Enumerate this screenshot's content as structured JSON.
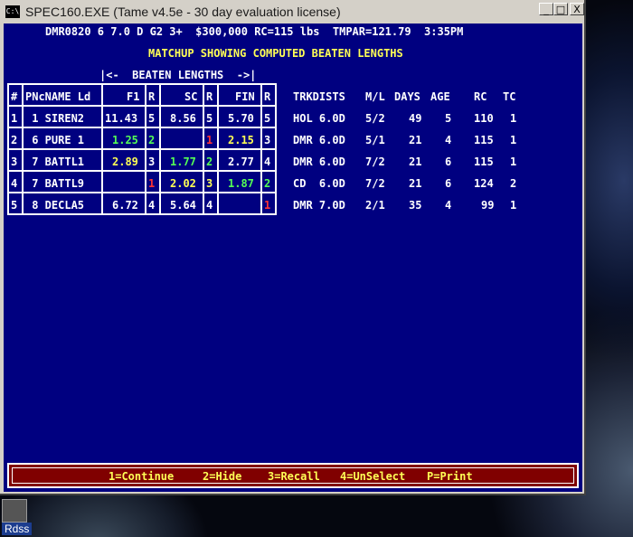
{
  "window": {
    "title": "SPEC160.EXE (Tame v4.5e - 30 day evaluation license)",
    "min_glyph": "_",
    "max_glyph": "□",
    "close_glyph": "X",
    "icon_text": "C:\\"
  },
  "header": {
    "race_info": "DMR0820 6 7.0 D G2 3+  $300,000 RC=115 lbs  TMPAR=121.79  3:35PM",
    "subtitle": "MATCHUP SHOWING COMPUTED BEATEN LENGTHS",
    "beaten_label": "|<-  BEATEN LENGTHS  ->|"
  },
  "table": {
    "headers": {
      "num": "#",
      "pn_name": "PNcNAME Ld",
      "f1": "F1",
      "r1": "R",
      "sc": "SC",
      "r2": "R",
      "fin": "FIN",
      "r3": "R",
      "trkdists": "TRKDISTS",
      "ml": "M/L",
      "days": "DAYS",
      "age": "AGE",
      "rc": "RC",
      "tc": "TC"
    },
    "rows": [
      {
        "num": "1",
        "pn_name": " 1 SIREN2",
        "f1": "11.43",
        "r1": "5",
        "sc": "8.56",
        "r2": "5",
        "fin": "5.70",
        "r3": "5",
        "trkdists": "HOL 6.0D",
        "ml": "5/2",
        "days": "49",
        "age": "5",
        "rc": "110",
        "tc": "1"
      },
      {
        "num": "2",
        "pn_name": " 6 PURE 1",
        "f1": "1.25",
        "r1": "2",
        "sc": "",
        "r2": "1",
        "fin": "2.15",
        "r3": "3",
        "trkdists": "DMR 6.0D",
        "ml": "5/1",
        "days": "21",
        "age": "4",
        "rc": "115",
        "tc": "1"
      },
      {
        "num": "3",
        "pn_name": " 7 BATTL1",
        "f1": "2.89",
        "r1": "3",
        "sc": "1.77",
        "r2": "2",
        "fin": "2.77",
        "r3": "4",
        "trkdists": "DMR 6.0D",
        "ml": "7/2",
        "days": "21",
        "age": "6",
        "rc": "115",
        "tc": "1"
      },
      {
        "num": "4",
        "pn_name": " 7 BATTL9",
        "f1": "",
        "r1": "1",
        "sc": "2.02",
        "r2": "3",
        "fin": "1.87",
        "r3": "2",
        "trkdists": "CD  6.0D",
        "ml": "7/2",
        "days": "21",
        "age": "6",
        "rc": "124",
        "tc": "2"
      },
      {
        "num": "5",
        "pn_name": " 8 DECLA5",
        "f1": "6.72",
        "r1": "4",
        "sc": "5.64",
        "r2": "4",
        "fin": "",
        "r3": "1",
        "trkdists": "DMR 7.0D",
        "ml": "2/1",
        "days": "35",
        "age": "4",
        "rc": "99",
        "tc": "1"
      }
    ]
  },
  "footer": {
    "continue": {
      "key": "1",
      "label": "=Continue"
    },
    "hide": {
      "key": "2",
      "label": "=Hide"
    },
    "recall": {
      "key": "3",
      "label": "=Recall"
    },
    "unselect": {
      "key": "4",
      "label": "=UnSelect"
    },
    "print": {
      "key": "P",
      "label": "=Print"
    }
  },
  "taskbar": {
    "label": "Rdss"
  },
  "colors": {
    "console_bg": "#000080",
    "highlight_yellow": "#ffff55",
    "highlight_green": "#55ff55",
    "highlight_red": "#ff3333",
    "footer_bg": "#800000"
  }
}
